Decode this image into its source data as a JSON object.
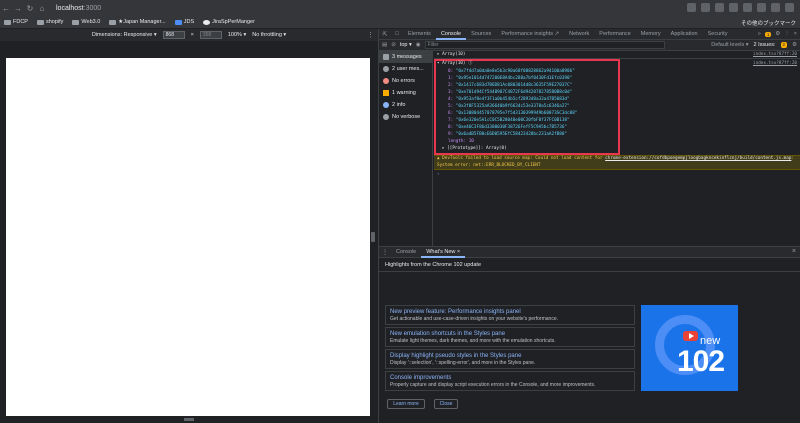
{
  "browser": {
    "url_host": "localhost",
    "url_port": ":3000",
    "bookmarks": [
      "FDCP",
      "shopify",
      "Web3.0",
      "★Japan Manager...",
      "JDS",
      "JiraSpPerManger"
    ],
    "bookmarks_right": "その他のブックマーク"
  },
  "device_toolbar": {
    "dimensions_label": "Dimensions: Responsive ▾",
    "width": "868",
    "height": "358",
    "zoom": "100% ▾",
    "throttling": "No throttling ▾"
  },
  "devtools": {
    "tabs": [
      "Elements",
      "Console",
      "Sources",
      "Performance insights ↗",
      "Network",
      "Performance",
      "Memory",
      "Application",
      "Security"
    ],
    "active_tab": "Console",
    "issues_count": "1",
    "context": "top ▾",
    "filter_placeholder": "Filter",
    "default_levels": "Default levels ▾",
    "issues_label": "2 Issues:",
    "issues_badge": "2"
  },
  "sidebar": [
    {
      "label": "3 messages",
      "icon": "list-icon",
      "color": "#9aa0a6"
    },
    {
      "label": "2 user mes...",
      "icon": "user-icon",
      "color": "#9aa0a6"
    },
    {
      "label": "No errors",
      "icon": "error-icon",
      "color": "#f28b82"
    },
    {
      "label": "1 warning",
      "icon": "warning-icon",
      "color": "#f9ab00"
    },
    {
      "label": "2 info",
      "icon": "info-icon",
      "color": "#8ab4f8"
    },
    {
      "label": "No verbose",
      "icon": "verbose-icon",
      "color": "#9aa0a6"
    }
  ],
  "console": {
    "line1": "▸ Array(10)",
    "line1_src": "index.tsx?87ff:20",
    "line2": "▾ Array(10) ⓘ",
    "line2_src": "index.tsx?87ff:20",
    "items": [
      {
        "k": "0:",
        "v": "\"0x7f4d7a0da0e8e5b3c90a68f08828862a94100a8906\""
      },
      {
        "k": "1:",
        "v": "\"0x95e1014d747200E8A4bc288a7bf0430Fd1Efc0390\""
      },
      {
        "k": "2:",
        "v": "\"0x1417c683d7B6D81Ac0803014d8c3635F59E27037C\""
      },
      {
        "k": "3:",
        "v": "\"0xe701d94Cf5448907C4872F6d9428782785B0B8c0d\""
      },
      {
        "k": "4:",
        "v": "\"0x953af8e4f3F1a0b454b5cf289348a33a47B5083d\""
      },
      {
        "k": "5:",
        "v": "\"0x3f0F5325aA36640b9f6634c53e3378a5c6346a27\""
      },
      {
        "k": "6:",
        "v": "\"0x130804457078795e7f5d3130399949b60073SC3dc08\""
      },
      {
        "k": "7:",
        "v": "\"0x6e320e5A1cC0C5B28040e00C30fbF0f37FC0B138\""
      },
      {
        "k": "8:",
        "v": "\"0xe46C3F86d3300030F38726FefF5C9A5bc7B5736\""
      },
      {
        "k": "9:",
        "v": "\"0x6a4B5FB0cE6D0595EfC58423428bc231aA2fB80\""
      }
    ],
    "length_line": "length: 10",
    "proto_line": "▸ [[Prototype]]: Array(0)",
    "warning_prefix": "▲ DevTools failed to load source map: Could not load content for ",
    "warning_link": "chrome-extension://cofdbpoegempjloogbagkncekinflcnj/build/content.js.map",
    "warning_suffix": ": System error: net::ERR_BLOCKED_BY_CLIENT",
    "prompt": "›"
  },
  "drawer": {
    "tabs": [
      "Console",
      "What's New ×"
    ],
    "active_tab": "What's New ×",
    "headline": "Highlights from the Chrome 102 update",
    "features": [
      {
        "title": "New preview feature: Performance insights panel",
        "desc": "Get actionable and use-case-driven insights on your website's performance."
      },
      {
        "title": "New emulation shortcuts in the Styles pane",
        "desc": "Emulate light themes, dark themes, and more with the emulation shortcuts."
      },
      {
        "title": "Display highlight pseudo styles in the Styles pane",
        "desc": "Display '::selection', '::spelling-error', and more in the Styles pane."
      },
      {
        "title": "Console improvements",
        "desc": "Properly capture and display script execution errors in the Console, and more improvements."
      }
    ],
    "learn_more": "Learn more",
    "close": "Close",
    "promo_new": "new",
    "promo_num": "102"
  }
}
